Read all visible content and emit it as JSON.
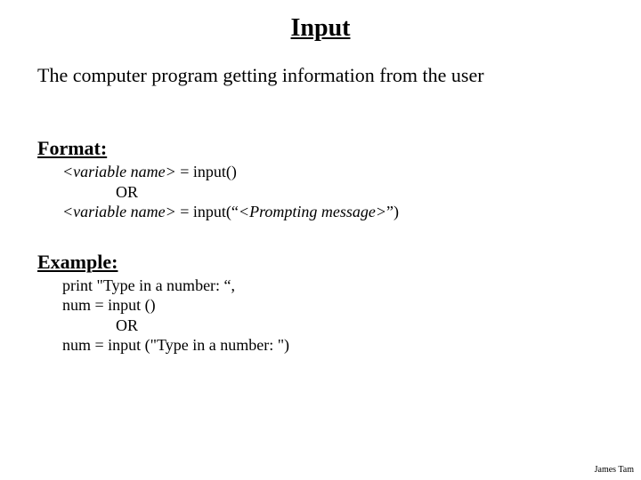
{
  "title": "Input",
  "tagline": "The computer program getting information from the user",
  "format": {
    "label": "Format:",
    "line1_var": "<variable name>",
    "line1_rest": " = input()",
    "or": "OR",
    "line2_var": "<variable name>",
    "line2_mid": " = input(“",
    "line2_prompt": "<Prompting message>",
    "line2_end": "”)"
  },
  "example": {
    "label": "Example:",
    "line1": "print \"Type in a number: “,",
    "line2": "num = input ()",
    "or": "OR",
    "line3": "num = input (\"Type in a number: \")"
  },
  "footer": "James Tam"
}
